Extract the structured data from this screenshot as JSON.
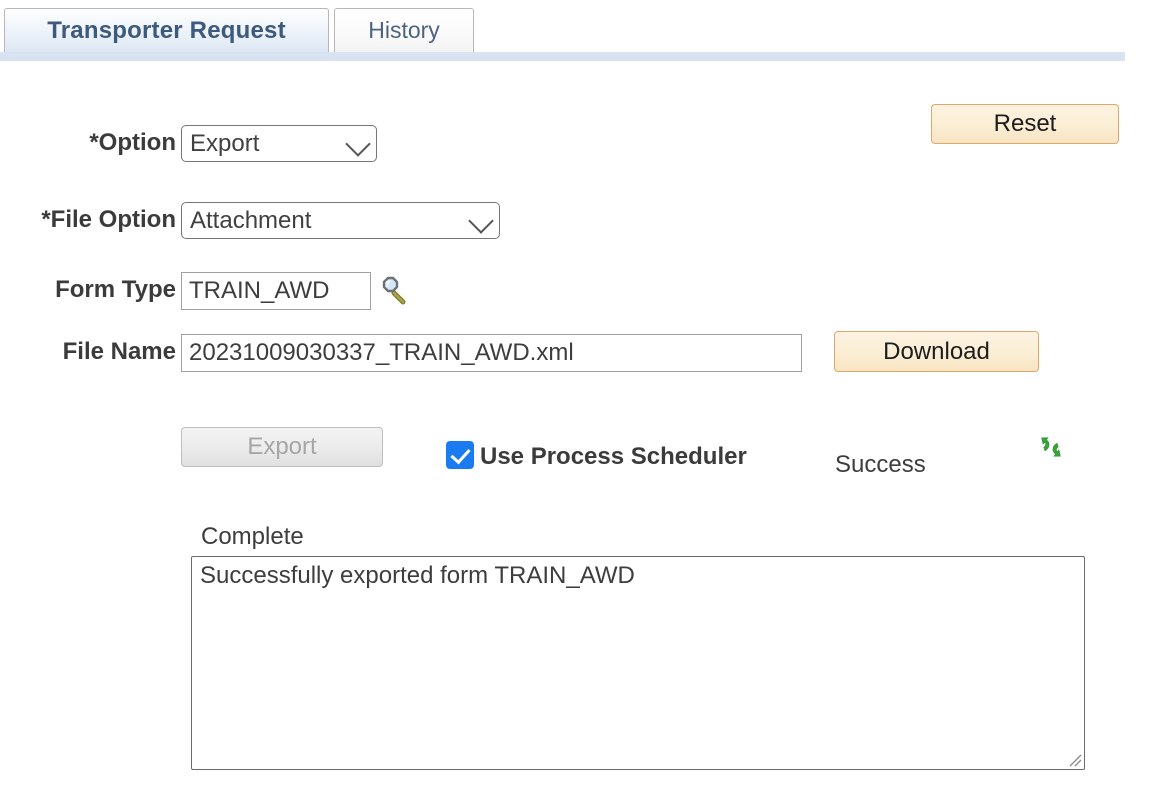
{
  "tabs": [
    {
      "label": "Transporter Request",
      "active": true
    },
    {
      "label": "History",
      "active": false
    }
  ],
  "toolbar": {
    "reset_label": "Reset",
    "download_label": "Download",
    "export_label": "Export"
  },
  "fields": {
    "option": {
      "label": "*Option",
      "value": "Export"
    },
    "file_option": {
      "label": "*File Option",
      "value": "Attachment"
    },
    "form_type": {
      "label": "Form Type",
      "value": "TRAIN_AWD",
      "lookup_icon": "magnifier-lookup-icon"
    },
    "file_name": {
      "label": "File Name",
      "value": "20231009030337_TRAIN_AWD.xml"
    }
  },
  "process": {
    "use_process_scheduler_label": "Use Process Scheduler",
    "use_process_scheduler_checked": true,
    "run_status": "Success",
    "refresh_icon": "refresh-cycle-icon",
    "distribution_status": "Complete",
    "log_message": "Successfully exported form TRAIN_AWD"
  },
  "colors": {
    "tab_active_text": "#3d5a7d",
    "tab_underline": "#d9e2f0",
    "button_face": "#fbeed4",
    "button_border": "#e0a86a",
    "checkbox_accent": "#1a7cf0",
    "refresh_green": "#3aa33a"
  }
}
